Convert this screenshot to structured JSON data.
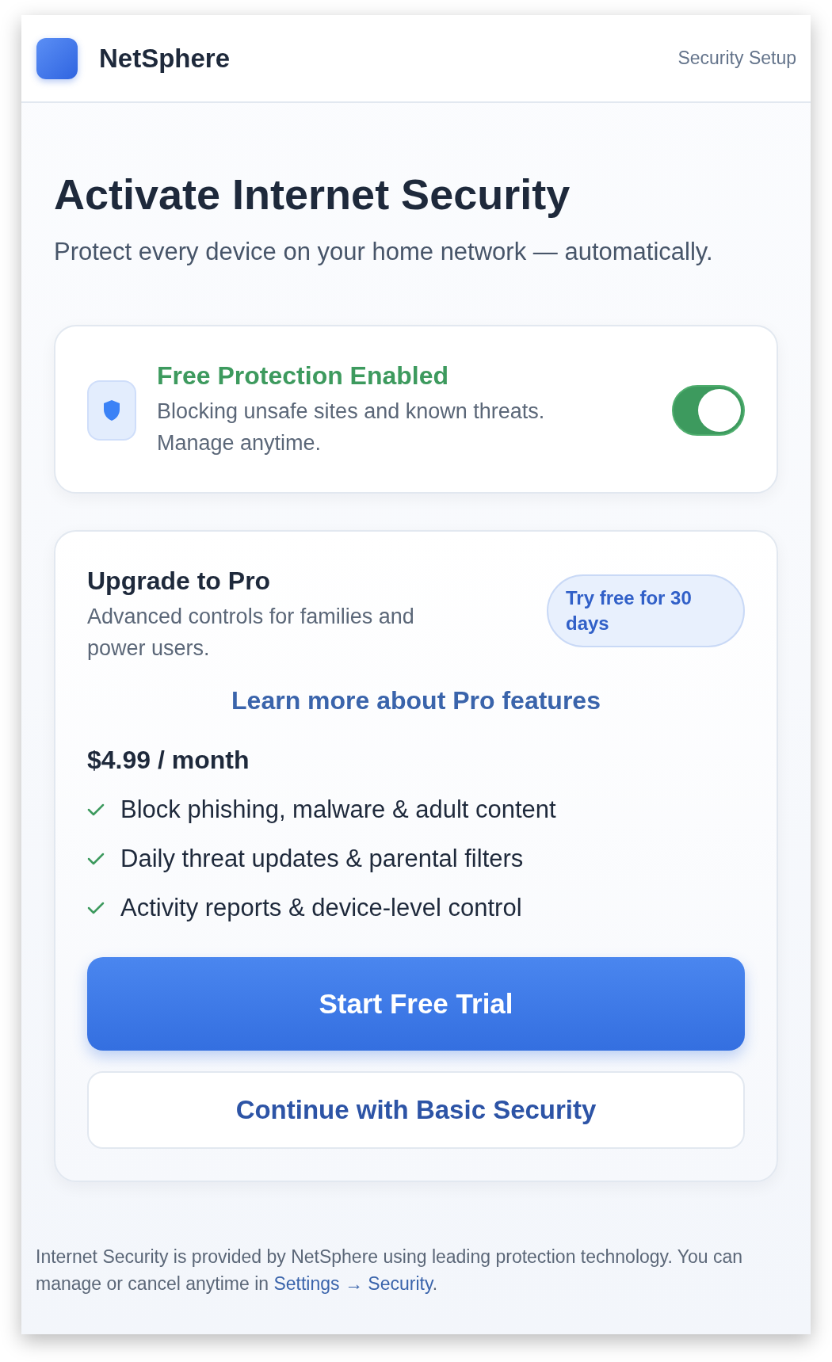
{
  "header": {
    "brand": "NetSphere",
    "page_label": "Security Setup"
  },
  "title": "Activate Internet Security",
  "subtitle": "Protect every device on your home network — automatically.",
  "free_protection": {
    "title": "Free Protection Enabled",
    "description": "Blocking unsafe sites and known threats. Manage anytime.",
    "on": true
  },
  "pro": {
    "title": "Upgrade to Pro",
    "description": "Advanced controls for families and power users.",
    "badge": "Try free for 30 days",
    "link": "Learn more about Pro features",
    "price": "$4.99 / month",
    "features": [
      "Block phishing, malware & adult content",
      "Daily threat updates & parental filters",
      "Activity reports & device-level control"
    ],
    "buttons": [
      {
        "label": "Start Free Trial",
        "kind": "primary"
      },
      {
        "label": "Continue with Basic Security",
        "kind": "secondary"
      }
    ]
  },
  "footer": {
    "text": "Internet Security is provided by NetSphere using leading protection technology. You can manage or cancel anytime in",
    "link": "Settings → Security",
    "end": "."
  }
}
